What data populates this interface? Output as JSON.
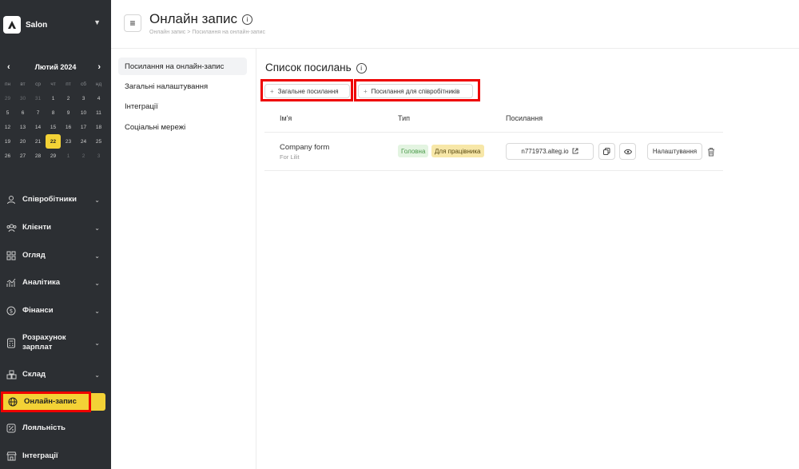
{
  "sidebar": {
    "brand": "Salon",
    "calendar": {
      "month": "Лютий 2024",
      "weekdays": [
        "пн",
        "вт",
        "ср",
        "чт",
        "пт",
        "сб",
        "нд"
      ],
      "days": [
        {
          "d": "29",
          "other": true
        },
        {
          "d": "30",
          "other": true
        },
        {
          "d": "31",
          "other": true
        },
        {
          "d": "1"
        },
        {
          "d": "2"
        },
        {
          "d": "3"
        },
        {
          "d": "4"
        },
        {
          "d": "5"
        },
        {
          "d": "6"
        },
        {
          "d": "7"
        },
        {
          "d": "8"
        },
        {
          "d": "9"
        },
        {
          "d": "10"
        },
        {
          "d": "11"
        },
        {
          "d": "12"
        },
        {
          "d": "13"
        },
        {
          "d": "14"
        },
        {
          "d": "15"
        },
        {
          "d": "16"
        },
        {
          "d": "17"
        },
        {
          "d": "18"
        },
        {
          "d": "19"
        },
        {
          "d": "20"
        },
        {
          "d": "21"
        },
        {
          "d": "22",
          "today": true
        },
        {
          "d": "23"
        },
        {
          "d": "24"
        },
        {
          "d": "25"
        },
        {
          "d": "26"
        },
        {
          "d": "27"
        },
        {
          "d": "28"
        },
        {
          "d": "29"
        },
        {
          "d": "1",
          "other": true
        },
        {
          "d": "2",
          "other": true
        },
        {
          "d": "3",
          "other": true
        }
      ]
    },
    "nav": [
      {
        "label": "Співробітники"
      },
      {
        "label": "Клієнти"
      },
      {
        "label": "Огляд"
      },
      {
        "label": "Аналітика"
      },
      {
        "label": "Фінанси"
      },
      {
        "label": "Розрахунок зарплат"
      },
      {
        "label": "Склад"
      },
      {
        "label": "Онлайн-запис"
      },
      {
        "label": "Лояльність"
      },
      {
        "label": "Інтеграції"
      }
    ]
  },
  "header": {
    "title": "Онлайн запис",
    "breadcrumb": [
      "Онлайн запис",
      "Посилання на онлайн-запис"
    ]
  },
  "settings_nav": [
    "Посилання на онлайн-запис",
    "Загальні налаштування",
    "Інтеграції",
    "Соціальні мережі"
  ],
  "main": {
    "title": "Список посилань",
    "btn_general": "Загальне посилання",
    "btn_staff": "Посилання для співробітників",
    "columns": [
      "Ім'я",
      "Тип",
      "Посилання"
    ],
    "row": {
      "name": "Company form",
      "sub": "For Lilit",
      "tag1": "Головна",
      "tag2": "Для працівника",
      "link": "n771973.alteg.io",
      "settings": "Налаштування"
    }
  },
  "colors": {
    "accent": "#f3d236",
    "highlight": "#e00000",
    "sidebar": "#2c2f33"
  }
}
